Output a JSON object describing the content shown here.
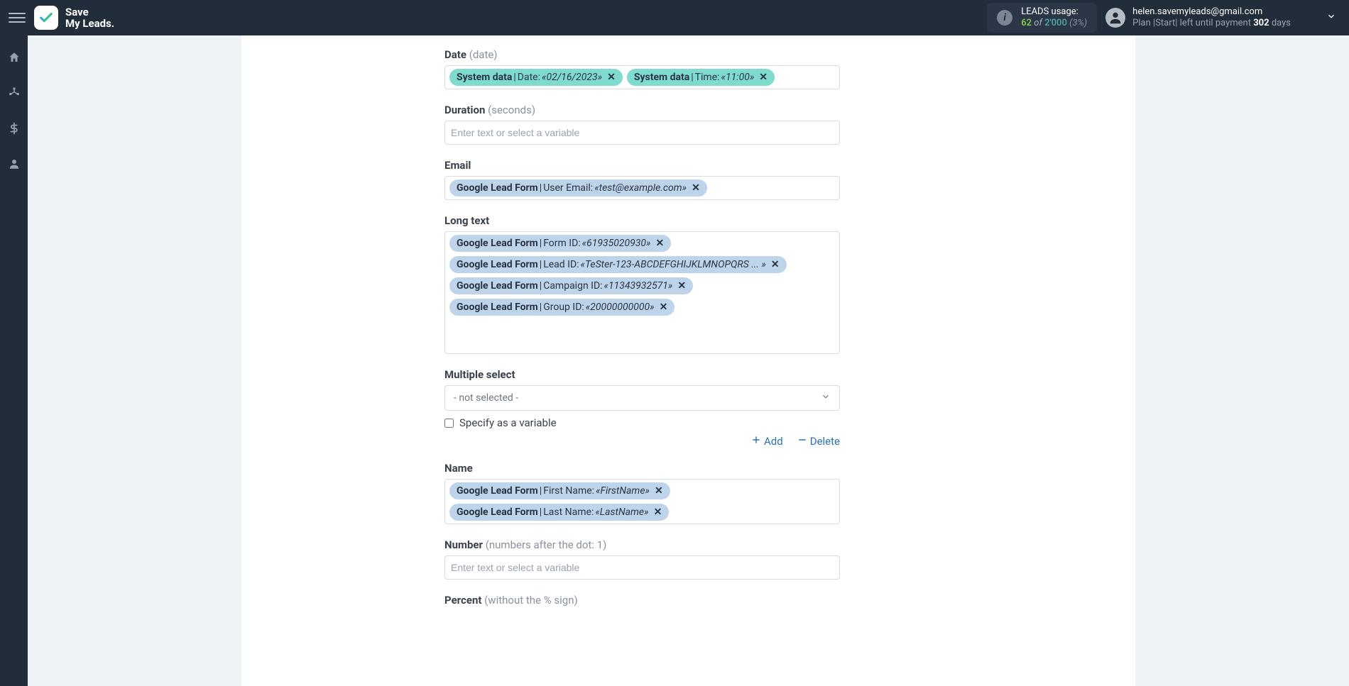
{
  "brand": {
    "line1": "Save",
    "line2": "My Leads."
  },
  "header": {
    "usage": {
      "title": "LEADS usage:",
      "used": "62",
      "of": "of",
      "total": "2'000",
      "percent": "(3%)"
    },
    "account": {
      "email": "helen.savemyleads@gmail.com",
      "plan_prefix": "Plan |",
      "plan_name": "Start",
      "plan_mid": "| left until payment",
      "days": "302",
      "days_suffix": "days"
    }
  },
  "form": {
    "date": {
      "label": "Date",
      "hint": "(date)",
      "tags": [
        {
          "source": "System data",
          "field": "Date:",
          "value": "«02/16/2023»",
          "theme": "teal"
        },
        {
          "source": "System data",
          "field": "Time:",
          "value": "«11:00»",
          "theme": "teal"
        }
      ]
    },
    "duration": {
      "label": "Duration",
      "hint": "(seconds)",
      "placeholder": "Enter text or select a variable"
    },
    "email": {
      "label": "Email",
      "tags": [
        {
          "source": "Google Lead Form",
          "field": "User Email:",
          "value": "«test@example.com»",
          "theme": "blue"
        }
      ]
    },
    "longtext": {
      "label": "Long text",
      "tags": [
        {
          "source": "Google Lead Form",
          "field": "Form ID:",
          "value": "«61935020930»",
          "theme": "blue"
        },
        {
          "source": "Google Lead Form",
          "field": "Lead ID:",
          "value": "«TeSter-123-ABCDEFGHIJKLMNOPQRS ... »",
          "theme": "blue"
        },
        {
          "source": "Google Lead Form",
          "field": "Campaign ID:",
          "value": "«11343932571»",
          "theme": "blue"
        },
        {
          "source": "Google Lead Form",
          "field": "Group ID:",
          "value": "«20000000000»",
          "theme": "blue"
        }
      ]
    },
    "multiselect": {
      "label": "Multiple select",
      "placeholder": "- not selected -",
      "checkbox_label": "Specify as a variable",
      "add": "Add",
      "delete": "Delete"
    },
    "name": {
      "label": "Name",
      "tags": [
        {
          "source": "Google Lead Form",
          "field": "First Name:",
          "value": "«FirstName»",
          "theme": "blue"
        },
        {
          "source": "Google Lead Form",
          "field": "Last Name:",
          "value": "«LastName»",
          "theme": "blue"
        }
      ]
    },
    "number": {
      "label": "Number",
      "hint": "(numbers after the dot: 1)",
      "placeholder": "Enter text or select a variable"
    },
    "percent": {
      "label": "Percent",
      "hint": "(without the % sign)"
    }
  }
}
